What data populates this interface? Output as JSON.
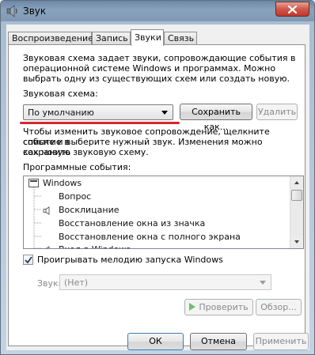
{
  "window": {
    "title": "Звук",
    "close_label": "×"
  },
  "tabs": [
    {
      "label": "Воспроизведение",
      "active": false
    },
    {
      "label": "Запись",
      "active": false
    },
    {
      "label": "Звуки",
      "active": true
    },
    {
      "label": "Связь",
      "active": false
    }
  ],
  "sounds": {
    "description": [
      "Звуковая схема задает звуки, сопровождающие события в",
      "операционной системе Windows и программах. Можно",
      "выбрать одну из существующих схем или создать новую."
    ],
    "scheme_label": "Звуковая схема:",
    "scheme_value": "По умолчанию",
    "save_as_label": "Сохранить как...",
    "delete_label": "Удалить",
    "change_help": [
      "Чтобы изменить звуковое сопровождение, щелкните событие в",
      "списке и выберите нужный звук. Изменения можно сохранить",
      "как новую звуковую схему."
    ],
    "events_label": "Программные события:",
    "events": [
      {
        "label": "Windows",
        "has_sound": false,
        "is_group": true
      },
      {
        "label": "Вопрос",
        "has_sound": false,
        "is_group": false
      },
      {
        "label": "Восклицание",
        "has_sound": true,
        "is_group": false
      },
      {
        "label": "Восстановление окна из значка",
        "has_sound": false,
        "is_group": false
      },
      {
        "label": "Восстановление окна с полного экрана",
        "has_sound": false,
        "is_group": false
      },
      {
        "label": "Вход в Windows",
        "has_sound": true,
        "is_group": false
      }
    ],
    "startup_label": "Проигрывать мелодию запуска Windows",
    "startup_checked": true,
    "sounds_label": "Звуки:",
    "sounds_value": "(Нет)",
    "test_label": "Проверить",
    "browse_label": "Обзор..."
  },
  "footer": {
    "ok_label": "ОК",
    "cancel_label": "Отмена",
    "apply_label": "Применить"
  },
  "colors": {
    "highlight_underline": "#d8262e",
    "title_bar": "#7b93ad"
  }
}
